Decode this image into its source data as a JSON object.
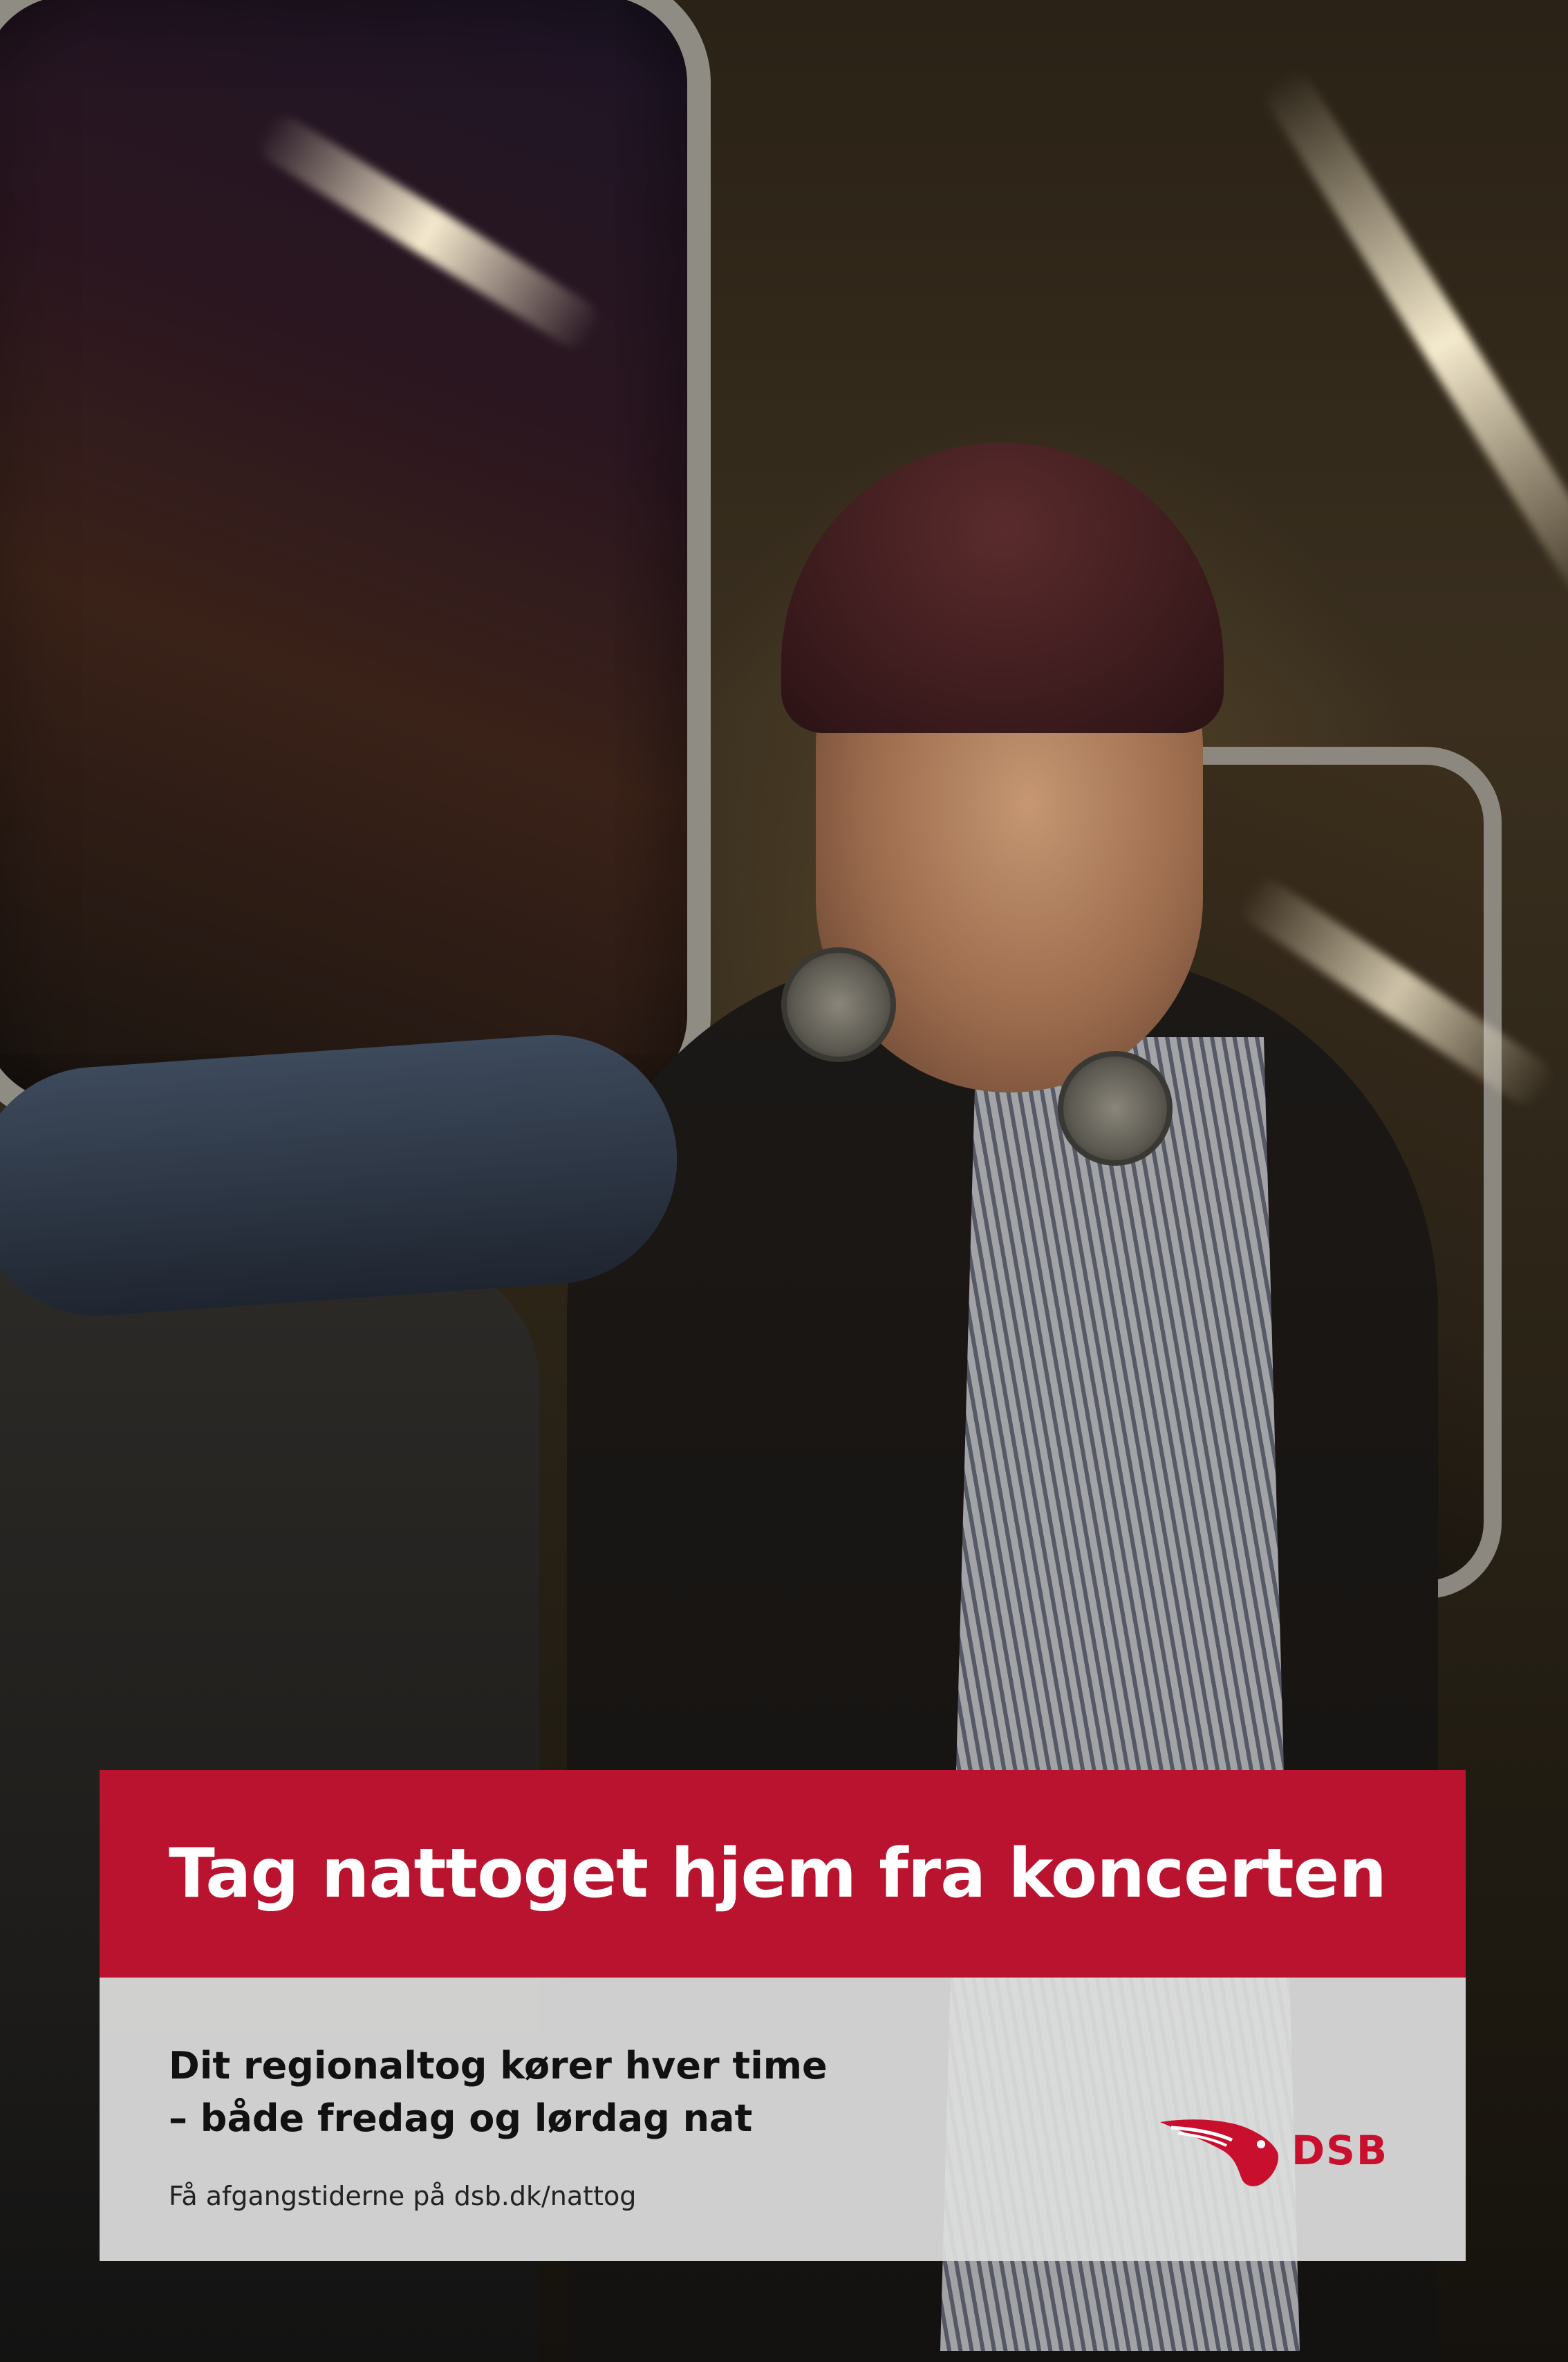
{
  "ad": {
    "headline": "Tag nattoget hjem fra koncerten",
    "subline_1": "Dit regionaltog kører hver time",
    "subline_2": "– både fredag og lørdag nat",
    "cta": "Få afgangstiderne på dsb.dk/nattog"
  },
  "brand": {
    "name": "DSB",
    "color": "#c8102e",
    "logo_icon": "dsb-wing-icon"
  },
  "colors": {
    "headline_band": "#b9132f",
    "info_box": "#dedede"
  }
}
